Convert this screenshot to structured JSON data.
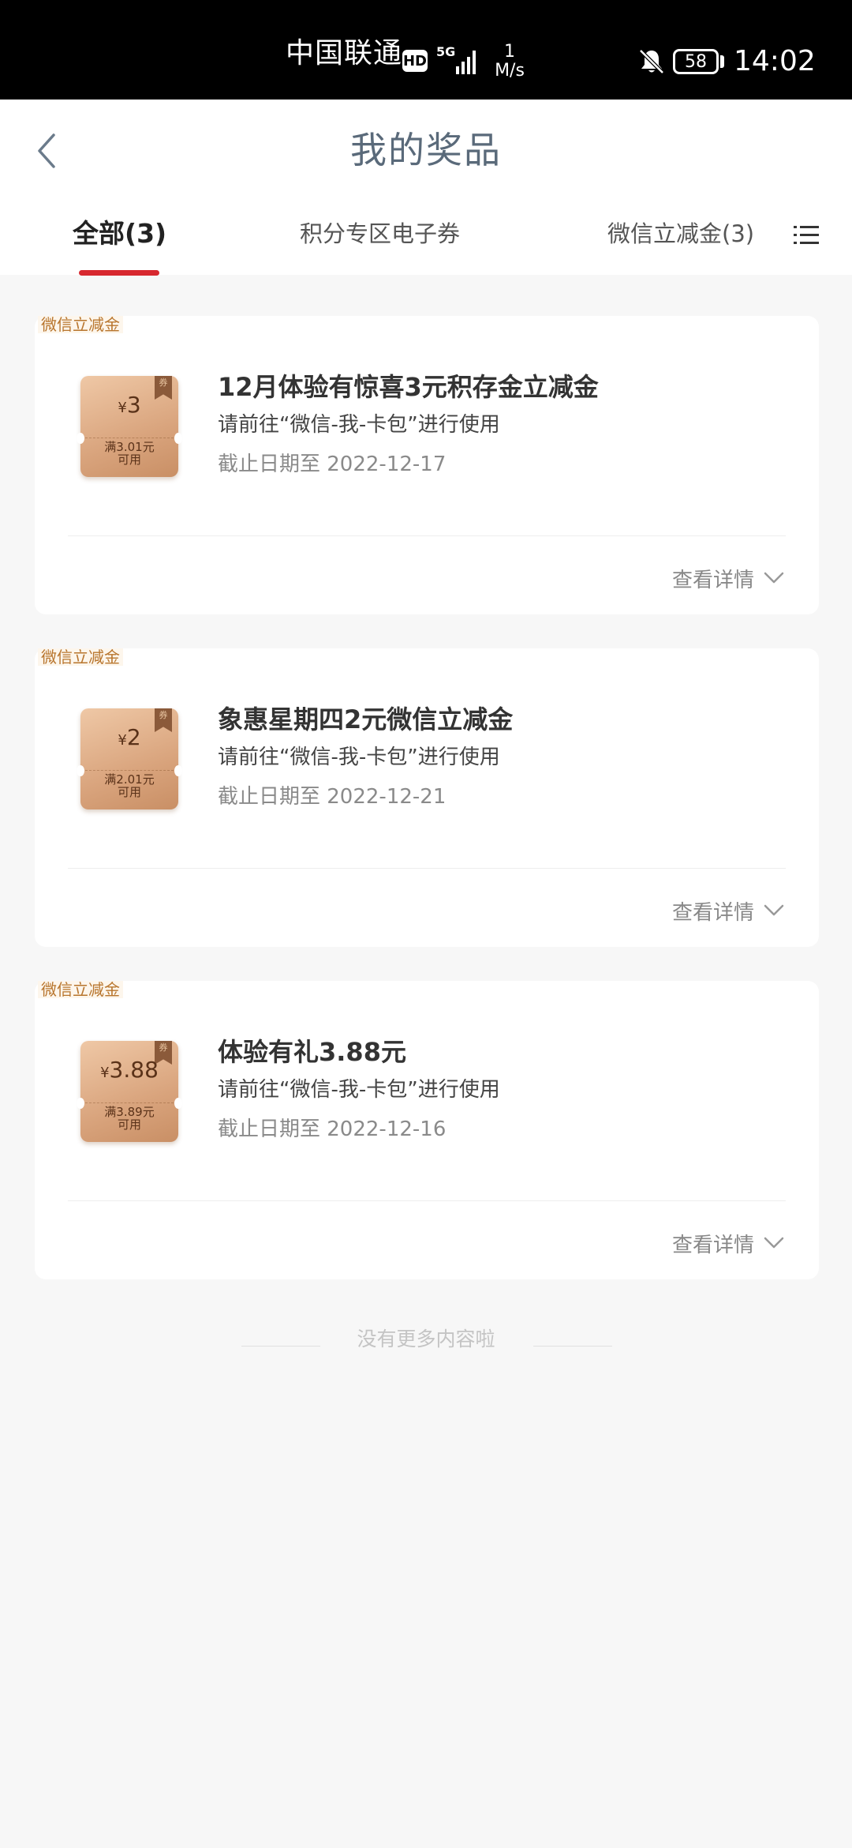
{
  "status_bar": {
    "carrier": "中国联通",
    "hd": "HD",
    "network": "5G",
    "speed_value": "1",
    "speed_unit": "M/s",
    "battery": "58",
    "time": "14:02"
  },
  "header": {
    "title": "我的奖品"
  },
  "tabs": [
    {
      "label": "全部(3)",
      "active": true
    },
    {
      "label": "积分专区电子券",
      "active": false
    },
    {
      "label": "微信立减金(3)",
      "active": false
    }
  ],
  "cards": [
    {
      "tag": "微信立减金",
      "coupon_currency": "¥",
      "coupon_amount": "3",
      "coupon_condition_line1": "满3.01元",
      "coupon_condition_line2": "可用",
      "coupon_badge": "券",
      "title": "12月体验有惊喜3元积存金立减金",
      "usage": "请前往“微信-我-卡包”进行使用",
      "deadline": "截止日期至 2022-12-17",
      "detail_label": "查看详情"
    },
    {
      "tag": "微信立减金",
      "coupon_currency": "¥",
      "coupon_amount": "2",
      "coupon_condition_line1": "满2.01元",
      "coupon_condition_line2": "可用",
      "coupon_badge": "券",
      "title": "象惠星期四2元微信立减金",
      "usage": "请前往“微信-我-卡包”进行使用",
      "deadline": "截止日期至 2022-12-21",
      "detail_label": "查看详情"
    },
    {
      "tag": "微信立减金",
      "coupon_currency": "¥",
      "coupon_amount": "3.88",
      "coupon_condition_line1": "满3.89元",
      "coupon_condition_line2": "可用",
      "coupon_badge": "券",
      "title": "体验有礼3.88元",
      "usage": "请前往“微信-我-卡包”进行使用",
      "deadline": "截止日期至 2022-12-16",
      "detail_label": "查看详情"
    }
  ],
  "footer": {
    "end_note": "没有更多内容啦"
  },
  "colors": {
    "accent": "#d7282f",
    "title": "#5a6a7a",
    "tag": "#b8752d"
  },
  "icons": {
    "back": "chevron-left-icon",
    "menu": "list-menu-icon",
    "detail": "chevron-down-icon",
    "bell": "bell-off-icon"
  }
}
